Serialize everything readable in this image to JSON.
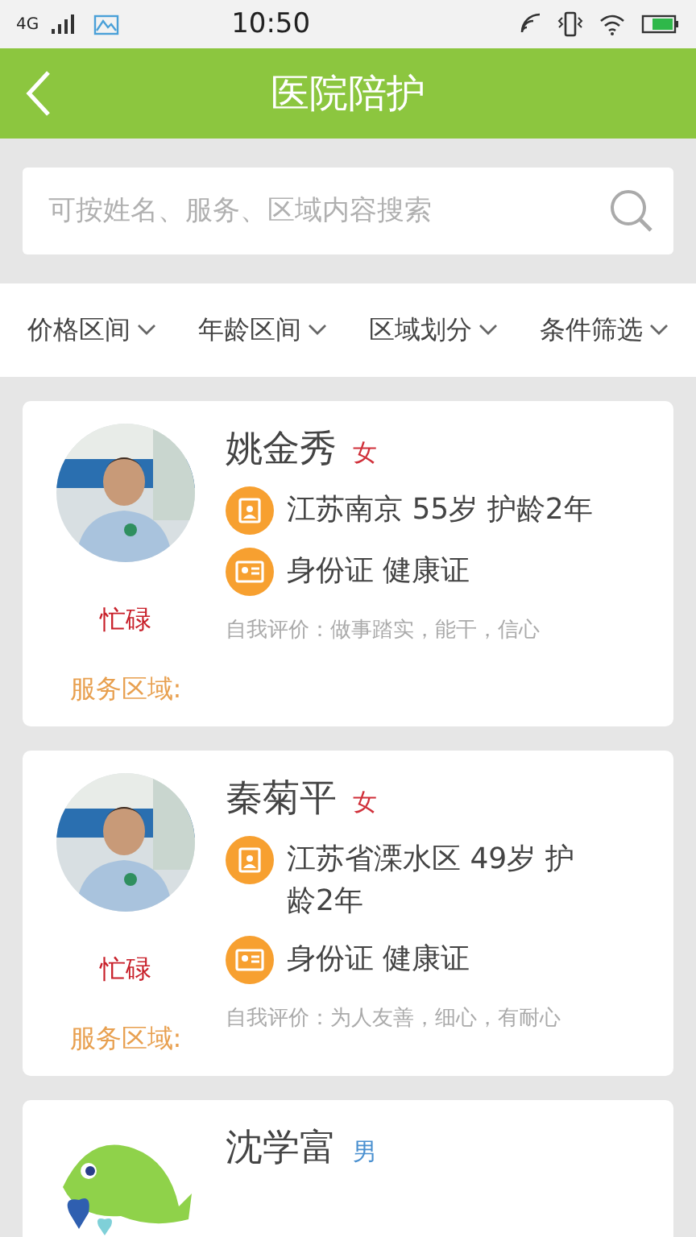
{
  "status_bar": {
    "network": "4G",
    "time": "10:50"
  },
  "header": {
    "title": "医院陪护"
  },
  "search": {
    "placeholder": "可按姓名、服务、区域内容搜索"
  },
  "filters": [
    {
      "label": "价格区间"
    },
    {
      "label": "年龄区间"
    },
    {
      "label": "区域划分"
    },
    {
      "label": "条件筛选"
    }
  ],
  "caregivers": [
    {
      "name": "姚金秀",
      "gender": "女",
      "color": "#d0303a",
      "info": "江苏南京 55岁 护龄2年",
      "certificates": "身份证 健康证",
      "status": "忙碌",
      "self_review": "自我评价：做事踏实，能干，信心",
      "service_area": "服务区域:"
    },
    {
      "name": "秦菊平",
      "gender": "女",
      "color": "#d0303a",
      "info": "江苏省溧水区 49岁 护龄2年",
      "certificates": "身份证 健康证",
      "status": "忙碌",
      "self_review": "自我评价：为人友善，细心，有耐心",
      "service_area": "服务区域:"
    },
    {
      "avatar": {
        "kind": "logo"
      },
      "name": "沈学富",
      "gender": "男",
      "color": "#4a90d0"
    }
  ]
}
